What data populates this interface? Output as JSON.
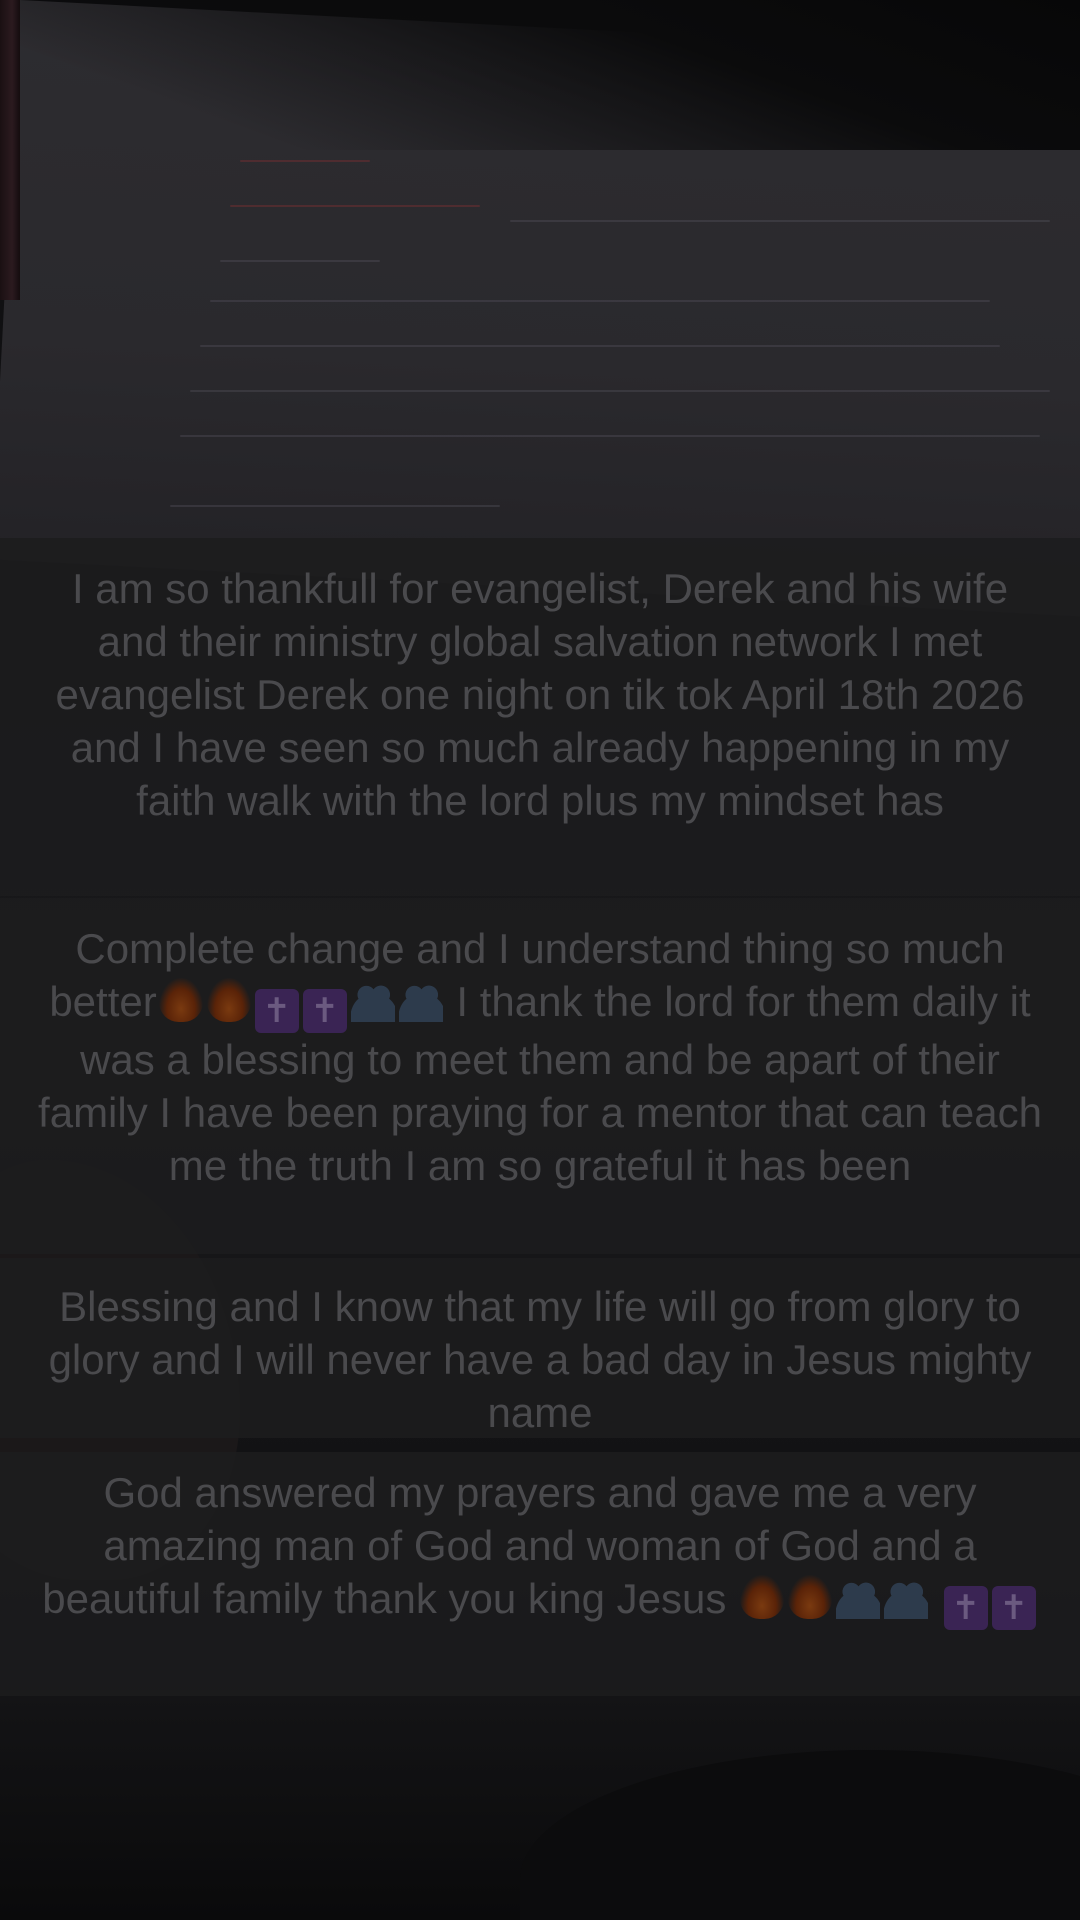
{
  "captions": [
    {
      "text": "I am so thankfull for evangelist, Derek and his wife and their ministry global salvation network I met evangelist Derek one night on tik tok April 18th 2026 and I have seen so much already happening in my faith walk with the lord plus my mindset has"
    },
    {
      "text_before_emoji": "Complete change and I understand thing so much better",
      "text_after_emoji": " I thank the lord for them daily it was a blessing to meet them and be apart of their family I have been praying for a mentor that can teach me the truth I am so grateful it has been",
      "emoji_icons": [
        "fire-icon",
        "fire-icon",
        "latin-cross-icon",
        "latin-cross-icon",
        "two-people-icon",
        "two-people-icon"
      ]
    },
    {
      "text": "Blessing and I know that my life will go from glory to glory and I will never have a bad day in Jesus mighty name"
    },
    {
      "text": "God answered my prayers and gave me a very amazing man of God and woman of God and a beautiful family thank you king Jesus",
      "emoji_icons": [
        "fire-icon",
        "fire-icon",
        "two-people-icon",
        "two-people-icon",
        "latin-cross-icon",
        "latin-cross-icon"
      ]
    }
  ],
  "emoji_glyphs": {
    "cross": "✝"
  },
  "colors": {
    "caption_background": "#1c1c1e",
    "caption_text": "#4a4a4d",
    "cross_emoji_bg": "#3a2454",
    "fire_emoji": "#7a3a10",
    "people_emoji": "#2d3b4c"
  }
}
